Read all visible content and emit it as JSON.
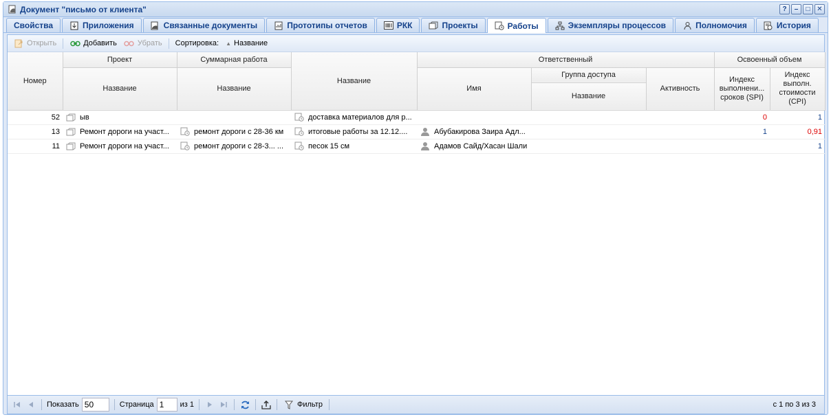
{
  "window": {
    "title": "Документ \"письмо от клиента\"",
    "buttons": [
      "?",
      "–",
      "□",
      "✕"
    ]
  },
  "tabs": [
    {
      "label": "Свойства",
      "icon": "properties"
    },
    {
      "label": "Приложения",
      "icon": "attachment-icon"
    },
    {
      "label": "Связанные документы",
      "icon": "linked-docs-icon"
    },
    {
      "label": "Прототипы отчетов",
      "icon": "report-icon"
    },
    {
      "label": "РКК",
      "icon": "barcode-icon"
    },
    {
      "label": "Проекты",
      "icon": "project-icon"
    },
    {
      "label": "Работы",
      "icon": "task-icon"
    },
    {
      "label": "Экземпляры процессов",
      "icon": "process-icon"
    },
    {
      "label": "Полномочия",
      "icon": "authority-icon"
    },
    {
      "label": "История",
      "icon": "history-icon"
    }
  ],
  "toolbar": {
    "open": "Открыть",
    "add": "Добавить",
    "remove": "Убрать",
    "sort_label": "Сортировка:",
    "sort_field": "Название"
  },
  "headers": {
    "number": "Номер",
    "project": "Проект",
    "project_name": "Название",
    "summary": "Суммарная работа",
    "summary_name": "Название",
    "name": "Название",
    "responsible": "Ответственный",
    "resp_name": "Имя",
    "access_group": "Группа доступа",
    "access_group_name": "Название",
    "activity": "Активность",
    "earned": "Освоенный объем",
    "spi": "Индекс выполнени... сроков (SPI)",
    "cpi": "Индекс выполн. стоимости (CPI)"
  },
  "rows": [
    {
      "number": "52",
      "project": "ыв",
      "summary": "",
      "name": "доставка материалов для р...",
      "person": "",
      "group": "",
      "activity": "",
      "spi": "0",
      "spi_color": "red",
      "cpi": "1",
      "cpi_color": "blue"
    },
    {
      "number": "13",
      "project": "Ремонт дороги на участ...",
      "summary": "ремонт дороги с 28-36 км",
      "name": "итоговые работы за 12.12....",
      "person": "Абубакирова Заира Адл...",
      "group": "",
      "activity": "",
      "spi": "1",
      "spi_color": "blue",
      "cpi": "0,91",
      "cpi_color": "red"
    },
    {
      "number": "11",
      "project": "Ремонт дороги на участ...",
      "summary": "ремонт дороги с 28-3... ...",
      "name": "песок 15 см",
      "person": "Адамов Сайд/Хасан Шали",
      "group": "",
      "activity": "",
      "spi": "",
      "spi_color": "blue",
      "cpi": "1",
      "cpi_color": "blue"
    }
  ],
  "paging": {
    "show_label": "Показать",
    "page_size": "50",
    "page_label": "Страница",
    "page": "1",
    "of_label": "из 1",
    "filter": "Фильтр",
    "summary": "с 1 по 3 из 3"
  }
}
